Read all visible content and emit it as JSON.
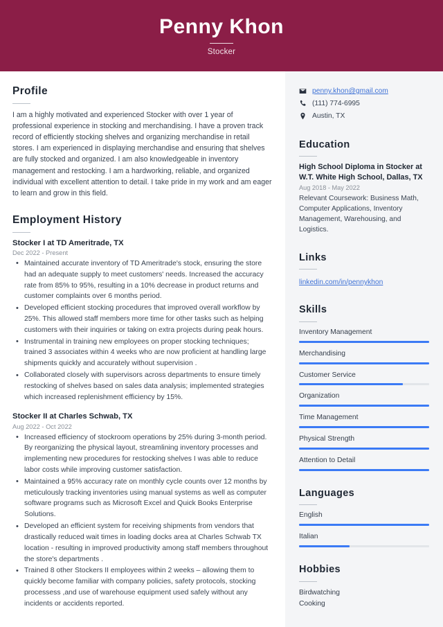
{
  "header": {
    "name": "Penny Khon",
    "job_title": "Stocker",
    "background_color": "#8B1E47"
  },
  "colors": {
    "accent_maroon": "#8B1E47",
    "link_blue": "#3f72d6",
    "meter_blue": "#3b7af5",
    "meter_track": "#e2e5e9",
    "sidebar_bg": "#F4F5F7",
    "body_text": "#3a4452",
    "muted_text": "#8a9099"
  },
  "main": {
    "profile": {
      "heading": "Profile",
      "text": "I am a highly motivated and experienced Stocker with over 1 year of professional experience in stocking and merchandising. I have a proven track record of efficiently stocking shelves and organizing merchandise in retail stores. I am experienced in displaying merchandise and ensuring that shelves are fully stocked and organized. I am also knowledgeable in inventory management and restocking. I am a hardworking, reliable, and organized individual with excellent attention to detail. I take pride in my work and am eager to learn and grow in this field."
    },
    "employment": {
      "heading": "Employment History",
      "jobs": [
        {
          "title": "Stocker I at TD Ameritrade, TX",
          "dates": "Dec 2022 - Present",
          "bullets": [
            "Maintained accurate inventory of TD Ameritrade's stock, ensuring the store had an adequate supply to meet customers' needs. Increased the accuracy rate from 85% to 95%, resulting in a 10% decrease in product returns and customer complaints over 6 months period.",
            "Developed efficient stocking procedures that improved overall workflow by 25%. This allowed staff members more time for other tasks such as helping customers with their inquiries or taking on extra projects during peak hours.",
            "Instrumental in training new employees on proper stocking techniques; trained 3 associates within 4 weeks who are now proficient at handling large shipments quickly and accurately without supervision .",
            "Collaborated closely with supervisors across departments to ensure timely restocking of shelves based on sales data analysis; implemented strategies which increased replenishment efficiency by 15%."
          ]
        },
        {
          "title": "Stocker II at Charles Schwab, TX",
          "dates": "Aug 2022 - Oct 2022",
          "bullets": [
            "Increased efficiency of stockroom operations by 25% during 3-month period. By reorganizing the physical layout, streamlining inventory processes and implementing new procedures for restocking shelves I was able to reduce labor costs while improving customer satisfaction.",
            "Maintained a 95% accuracy rate on monthly cycle counts over 12 months by meticulously tracking inventories using manual systems as well as computer software programs such as Microsoft Excel and Quick Books Enterprise Solutions.",
            "Developed an efficient system for receiving shipments from vendors that drastically reduced wait times in loading docks area at Charles Schwab TX location - resulting in improved productivity among staff members throughout the store's departments .",
            "Trained 8 other Stockers II employees within 2 weeks – allowing them to quickly become familiar with company policies, safety protocols, stocking processess ,and use of warehouse equipment used safely without any incidents or accidents reported."
          ]
        }
      ]
    }
  },
  "sidebar": {
    "contact": [
      {
        "icon": "envelope-icon",
        "value": "penny.khon@gmail.com",
        "is_link": true
      },
      {
        "icon": "phone-icon",
        "value": "(111) 774-6995",
        "is_link": false
      },
      {
        "icon": "location-pin-icon",
        "value": "Austin, TX",
        "is_link": false
      }
    ],
    "education": {
      "heading": "Education",
      "entries": [
        {
          "title": "High School Diploma in Stocker at W.T. White High School, Dallas, TX",
          "dates": "Aug 2018 - May 2022",
          "description": "Relevant Coursework: Business Math, Computer Applications, Inventory Management, Warehousing, and Logistics."
        }
      ]
    },
    "links": {
      "heading": "Links",
      "items": [
        {
          "label": "linkedin.com/in/pennykhon"
        }
      ]
    },
    "skills": {
      "heading": "Skills",
      "items": [
        {
          "label": "Inventory Management",
          "level": 100
        },
        {
          "label": "Merchandising",
          "level": 100
        },
        {
          "label": "Customer Service",
          "level": 80
        },
        {
          "label": "Organization",
          "level": 100
        },
        {
          "label": "Time Management",
          "level": 100
        },
        {
          "label": "Physical Strength",
          "level": 100
        },
        {
          "label": "Attention to Detail",
          "level": 100
        }
      ]
    },
    "languages": {
      "heading": "Languages",
      "items": [
        {
          "label": "English",
          "level": 100
        },
        {
          "label": "Italian",
          "level": 39
        }
      ]
    },
    "hobbies": {
      "heading": "Hobbies",
      "items": [
        {
          "label": "Birdwatching"
        },
        {
          "label": "Cooking"
        }
      ]
    }
  }
}
